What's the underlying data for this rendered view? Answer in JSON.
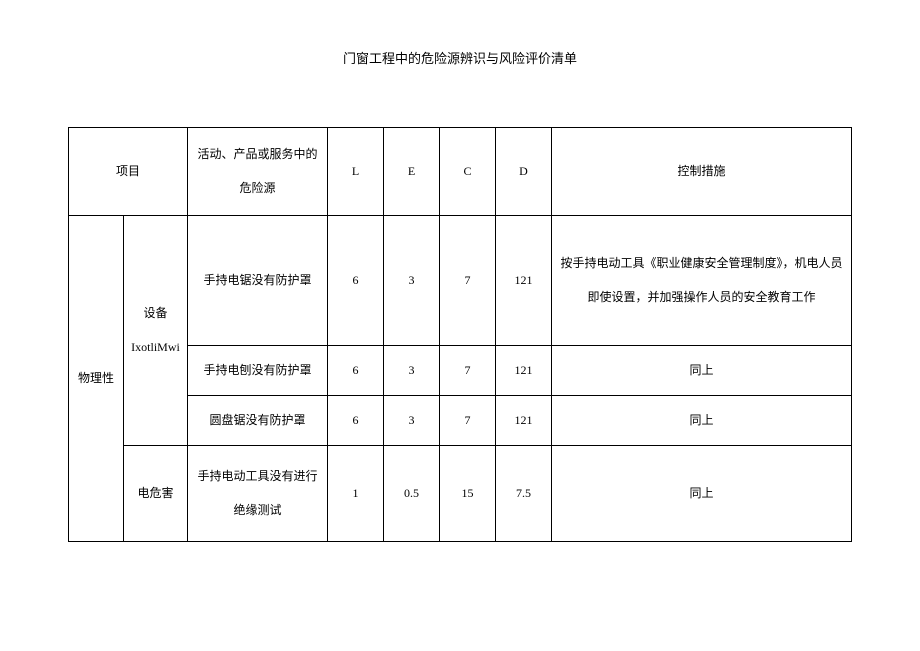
{
  "title": "门窗工程中的危险源辨识与风险评价清单",
  "headers": {
    "project": "项目",
    "hazard": "活动、产品或服务中的危险源",
    "L": "L",
    "E": "E",
    "C": "C",
    "D": "D",
    "measure": "控制措施"
  },
  "category1": "物理性",
  "subcat1": "设备IxotliMwi",
  "subcat2": "电危害",
  "rows": [
    {
      "hazard": "手持电锯没有防护罩",
      "L": "6",
      "E": "3",
      "C": "7",
      "D": "121",
      "measure": "按手持电动工具《职业健康安全管理制度》，机电人员即使设置，并加强操作人员的安全教育工作"
    },
    {
      "hazard": "手持电刨没有防护罩",
      "L": "6",
      "E": "3",
      "C": "7",
      "D": "121",
      "measure": "同上"
    },
    {
      "hazard": "圆盘锯没有防护罩",
      "L": "6",
      "E": "3",
      "C": "7",
      "D": "121",
      "measure": "同上"
    },
    {
      "hazard": "手持电动工具没有进行绝缘测试",
      "L": "1",
      "E": "0.5",
      "C": "15",
      "D": "7.5",
      "measure": "同上"
    }
  ]
}
